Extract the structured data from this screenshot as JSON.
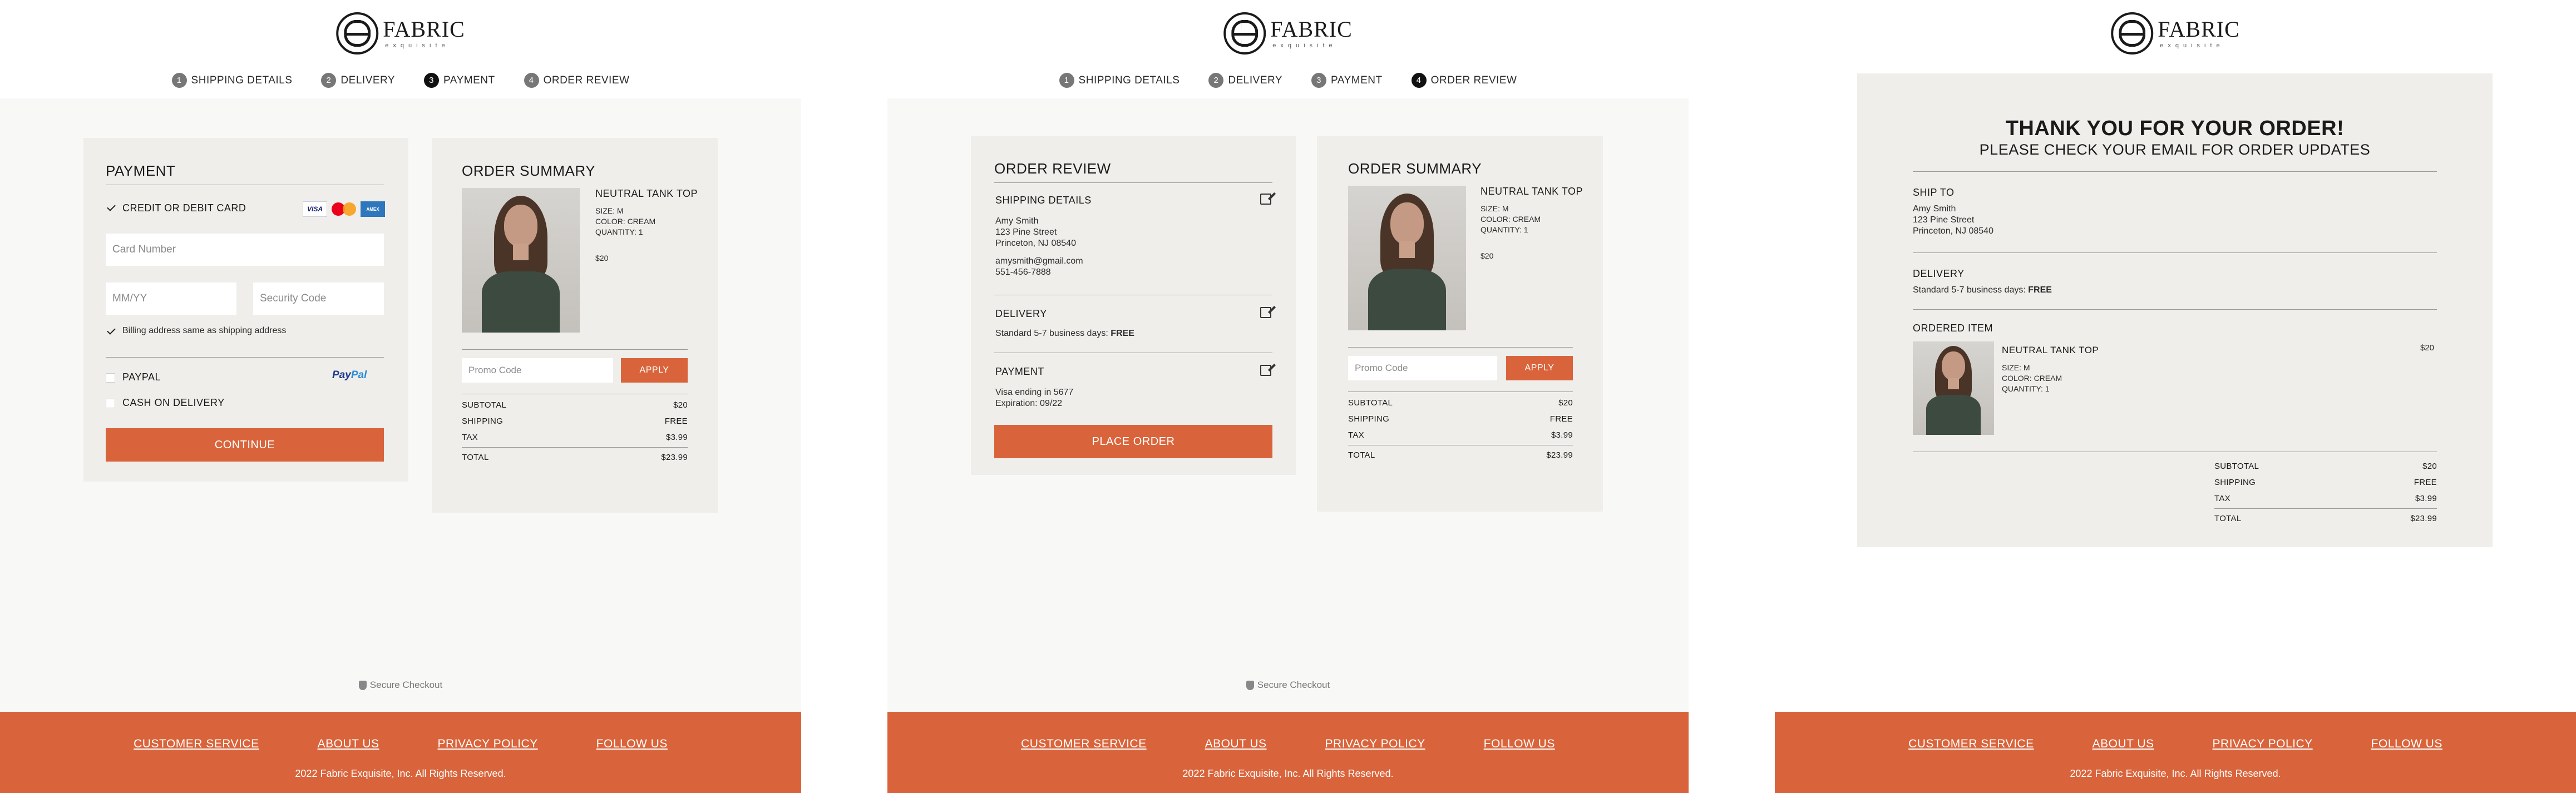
{
  "brand": {
    "name": "FABRIC",
    "tagline": "exquisite"
  },
  "steps": [
    {
      "num": "1",
      "label": "SHIPPING DETAILS"
    },
    {
      "num": "2",
      "label": "DELIVERY"
    },
    {
      "num": "3",
      "label": "PAYMENT"
    },
    {
      "num": "4",
      "label": "ORDER REVIEW"
    }
  ],
  "product": {
    "name": "NEUTRAL TANK TOP",
    "size": "SIZE: M",
    "color": "COLOR: CREAM",
    "quantity": "QUANTITY: 1",
    "price": "$20"
  },
  "summary": {
    "title": "ORDER SUMMARY",
    "promo_placeholder": "Promo Code",
    "apply_label": "APPLY",
    "subtotal_label": "SUBTOTAL",
    "subtotal": "$20",
    "shipping_label": "SHIPPING",
    "shipping": "FREE",
    "tax_label": "TAX",
    "tax": "$3.99",
    "total_label": "TOTAL",
    "total": "$23.99"
  },
  "payment": {
    "title": "PAYMENT",
    "card_option": "CREDIT OR DEBIT CARD",
    "card_number_placeholder": "Card Number",
    "expiry_placeholder": "MM/YY",
    "security_placeholder": "Security Code",
    "billing_same": "Billing address same as shipping address",
    "paypal_option": "PAYPAL",
    "cod_option": "CASH ON DELIVERY",
    "continue_label": "CONTINUE",
    "paypal_logo": "Pay",
    "paypal_logo2": "Pal",
    "visa_logo": "VISA",
    "amex_logo": "AMEX"
  },
  "review": {
    "title": "ORDER REVIEW",
    "shipping_title": "SHIPPING DETAILS",
    "name": "Amy Smith",
    "street": "123 Pine Street",
    "city": "Princeton, NJ 08540",
    "email": "amysmith@gmail.com",
    "phone": "551-456-7888",
    "delivery_title": "DELIVERY",
    "delivery_text": "Standard 5-7 business days: ",
    "delivery_free": "FREE",
    "payment_title": "PAYMENT",
    "card_text": "Visa ending in 5677",
    "expiration": "Expiration: 09/22",
    "place_order_label": "PLACE ORDER"
  },
  "confirmation": {
    "title": "THANK YOU FOR YOUR ORDER!",
    "subtitle": "PLEASE CHECK YOUR EMAIL FOR ORDER UPDATES",
    "ship_to_title": "SHIP TO",
    "delivery_title": "DELIVERY",
    "delivery_text": "Standard 5-7 business days: ",
    "delivery_free": "FREE",
    "ordered_title": "ORDERED ITEM"
  },
  "secure_checkout": "Secure Checkout",
  "footer": {
    "links": [
      "CUSTOMER SERVICE",
      "ABOUT US",
      "PRIVACY POLICY",
      "FOLLOW US"
    ],
    "copyright": "2022 Fabric Exquisite, Inc. All Rights Reserved."
  },
  "colors": {
    "accent": "#d9643b",
    "panel": "#efeeeb",
    "background": "#f8f8f7"
  }
}
